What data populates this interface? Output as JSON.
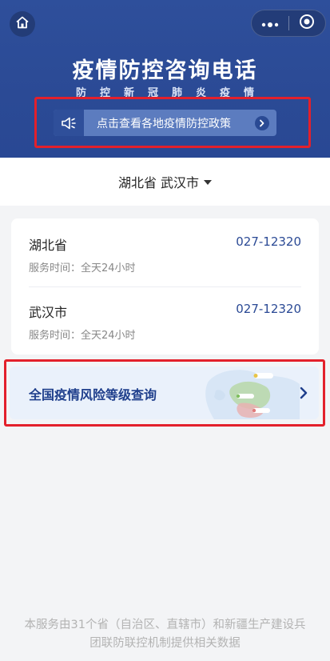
{
  "header": {
    "title": "疫情防控咨询电话",
    "subtitle": "防控新冠肺炎疫情",
    "policy_label": "点击查看各地疫情防控政策"
  },
  "icons": {
    "home": "home-icon",
    "more": "more-dots-icon",
    "close": "close-circle-icon",
    "horn": "megaphone-icon",
    "arrow": "arrow-right-icon"
  },
  "region": {
    "label": "湖北省 武汉市"
  },
  "hotlines": [
    {
      "name": "湖北省",
      "phone": "027-12320",
      "hours": "服务时间：全天24小时"
    },
    {
      "name": "武汉市",
      "phone": "027-12320",
      "hours": "服务时间：全天24小时"
    }
  ],
  "risk": {
    "label": "全国疫情风险等级查询"
  },
  "footer": {
    "line1": "本服务由31个省（自治区、直辖市）和新疆生产建设兵",
    "line2": "团联防联控机制提供相关数据"
  },
  "colors": {
    "brand_blue": "#2b4a95",
    "highlight_red": "#e3202b",
    "policy_bar": "#5c7cbf"
  }
}
